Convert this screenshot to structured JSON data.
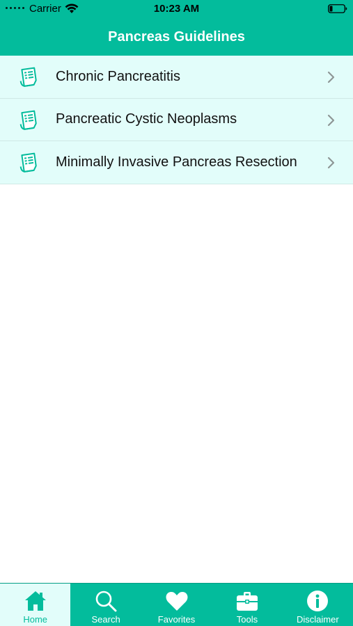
{
  "status_bar": {
    "carrier": "Carrier",
    "time": "10:23 AM",
    "icons": [
      "signal-dots-icon",
      "wifi-icon",
      "battery-icon"
    ]
  },
  "nav": {
    "title": "Pancreas Guidelines"
  },
  "list": {
    "items": [
      {
        "label": "Chronic Pancreatitis",
        "icon": "document-icon"
      },
      {
        "label": "Pancreatic Cystic Neoplasms",
        "icon": "document-icon"
      },
      {
        "label": "Minimally Invasive Pancreas Resection",
        "icon": "document-icon"
      }
    ]
  },
  "tabs": {
    "items": [
      {
        "label": "Home",
        "icon": "home-icon",
        "active": true
      },
      {
        "label": "Search",
        "icon": "search-icon",
        "active": false
      },
      {
        "label": "Favorites",
        "icon": "heart-icon",
        "active": false
      },
      {
        "label": "Tools",
        "icon": "briefcase-icon",
        "active": false
      },
      {
        "label": "Disclaimer",
        "icon": "info-icon",
        "active": false
      }
    ]
  },
  "colors": {
    "brand": "#03bc9c",
    "list_background": "#e2fdfa",
    "text": "#111111"
  }
}
